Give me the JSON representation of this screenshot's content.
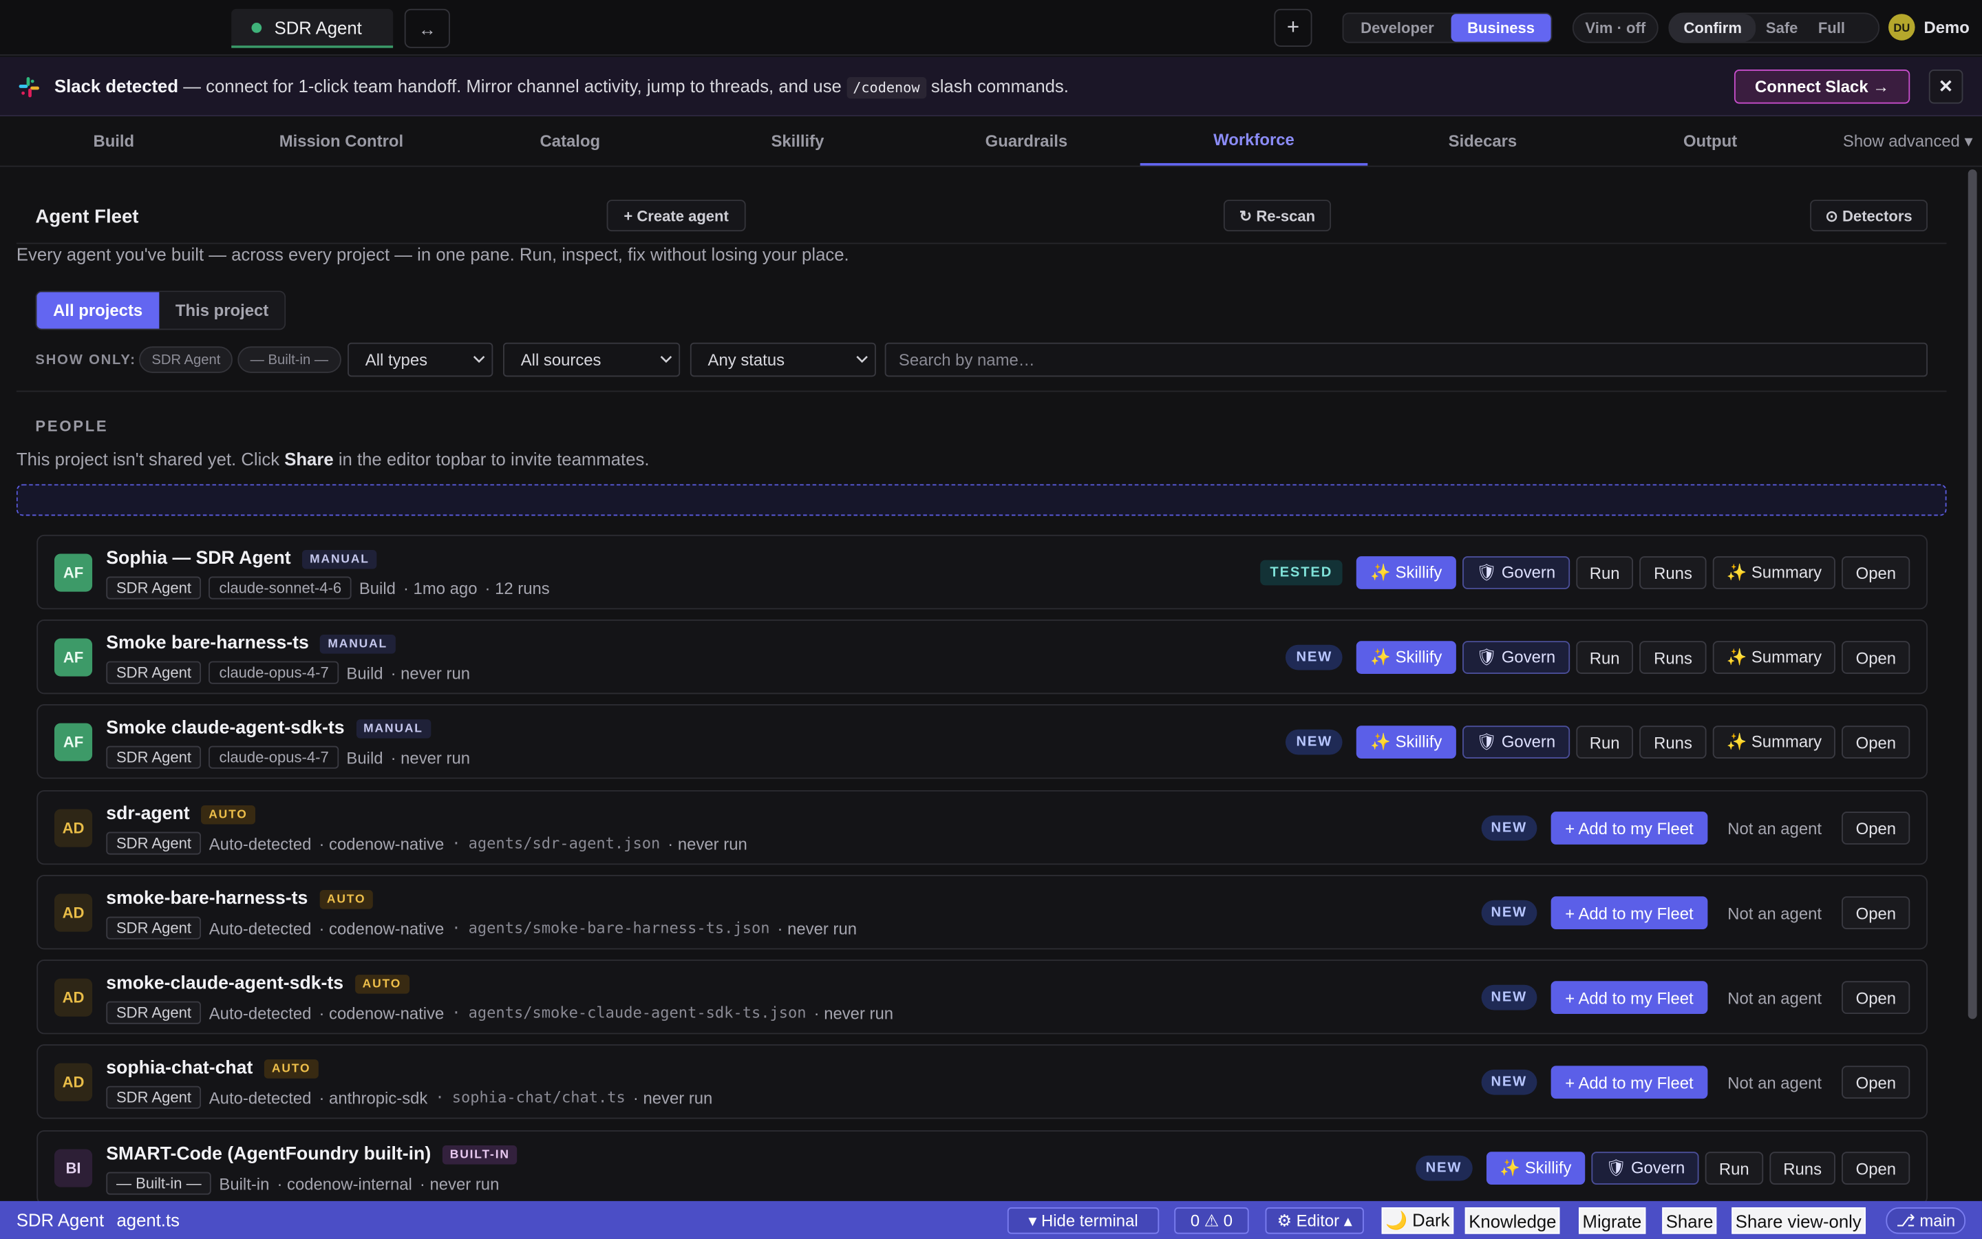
{
  "topbar": {
    "tab_label": "SDR Agent",
    "swap_label": "↔",
    "new_label": "+",
    "modes": [
      "Developer",
      "Business"
    ],
    "active_mode": "Business",
    "vim_label": "Vim · off",
    "safety": [
      "Confirm",
      "Safe",
      "Full"
    ],
    "active_safety": "Confirm",
    "user_initials": "DU",
    "user_name": "Demo"
  },
  "banner": {
    "title": "Slack detected",
    "text_before": " — connect for 1-click team handoff. Mirror channel activity, jump to threads, and use ",
    "code": "/codenow",
    "text_after": " slash commands.",
    "connect_label": "Connect Slack →",
    "close_label": "✕"
  },
  "nav": {
    "tabs": [
      "Build",
      "Mission Control",
      "Catalog",
      "Skillify",
      "Guardrails",
      "Workforce",
      "Sidecars",
      "Output"
    ],
    "active": "Workforce",
    "show_advanced": "Show advanced ▾"
  },
  "fleet": {
    "title": "Agent Fleet",
    "create_label": "+ Create agent",
    "rescan_label": "↻ Re-scan",
    "detectors_label": "⊙ Detectors",
    "subtitle": "Every agent you've built — across every project — in one pane. Run, inspect, fix without losing your place.",
    "scope": [
      "All projects",
      "This project"
    ],
    "active_scope": "All projects"
  },
  "filters": {
    "label": "SHOW ONLY:",
    "chips": [
      "SDR Agent",
      "— Built-in —"
    ],
    "types": "All types",
    "sources": "All sources",
    "status": "Any status",
    "search_placeholder": "Search by name…"
  },
  "people": {
    "heading": "PEOPLE",
    "text_before": "This project isn't shared yet. Click ",
    "text_bold": "Share",
    "text_after": " in the editor topbar to invite teammates."
  },
  "agents": [
    {
      "initials": "AF",
      "name": "Sophia — SDR Agent",
      "tag": "MANUAL",
      "project": "SDR Agent",
      "model": "claude-sonnet-4-6",
      "meta": "Build",
      "extra": "· 1mo ago",
      "extra2": "· 12 runs",
      "status": "TESTED",
      "actions": [
        "✨ Skillify",
        "🛡 Govern",
        "Run",
        "Runs",
        "✨ Summary",
        "Open"
      ]
    },
    {
      "initials": "AF",
      "name": "Smoke bare-harness-ts",
      "tag": "MANUAL",
      "project": "SDR Agent",
      "model": "claude-opus-4-7",
      "meta": "Build",
      "extra": "· never run",
      "status": "NEW",
      "actions": [
        "✨ Skillify",
        "🛡 Govern",
        "Run",
        "Runs",
        "✨ Summary",
        "Open"
      ]
    },
    {
      "initials": "AF",
      "name": "Smoke claude-agent-sdk-ts",
      "tag": "MANUAL",
      "project": "SDR Agent",
      "model": "claude-opus-4-7",
      "meta": "Build",
      "extra": "· never run",
      "status": "NEW",
      "actions": [
        "✨ Skillify",
        "🛡 Govern",
        "Run",
        "Runs",
        "✨ Summary",
        "Open"
      ]
    },
    {
      "initials": "AD",
      "name": "sdr-agent",
      "tag": "AUTO",
      "project": "SDR Agent",
      "meta": "Auto-detected",
      "source": "· codenow-native",
      "path": "agents/sdr-agent.json",
      "extra": "· never run",
      "status": "NEW",
      "actions": [
        "+ Add to my Fleet",
        "Not an agent",
        "Open"
      ]
    },
    {
      "initials": "AD",
      "name": "smoke-bare-harness-ts",
      "tag": "AUTO",
      "project": "SDR Agent",
      "meta": "Auto-detected",
      "source": "· codenow-native",
      "path": "agents/smoke-bare-harness-ts.json",
      "extra": "· never run",
      "status": "NEW",
      "actions": [
        "+ Add to my Fleet",
        "Not an agent",
        "Open"
      ]
    },
    {
      "initials": "AD",
      "name": "smoke-claude-agent-sdk-ts",
      "tag": "AUTO",
      "project": "SDR Agent",
      "meta": "Auto-detected",
      "source": "· codenow-native",
      "path": "agents/smoke-claude-agent-sdk-ts.json",
      "extra": "· never run",
      "status": "NEW",
      "actions": [
        "+ Add to my Fleet",
        "Not an agent",
        "Open"
      ]
    },
    {
      "initials": "AD",
      "name": "sophia-chat-chat",
      "tag": "AUTO",
      "project": "SDR Agent",
      "meta": "Auto-detected",
      "source": "· anthropic-sdk",
      "path": "sophia-chat/chat.ts",
      "extra": "· never run",
      "status": "NEW",
      "actions": [
        "+ Add to my Fleet",
        "Not an agent",
        "Open"
      ]
    },
    {
      "initials": "BI",
      "name": "SMART-Code (AgentFoundry built-in)",
      "tag": "BUILT-IN",
      "project": "— Built-in —",
      "meta": "Built-in",
      "source": "· codenow-internal",
      "extra": "· never run",
      "status": "NEW",
      "actions": [
        "✨ Skillify",
        "🛡 Govern",
        "Run",
        "Runs",
        "Open"
      ]
    }
  ],
  "statusbar": {
    "project": "SDR Agent",
    "file": "agent.ts",
    "hide_terminal": "▾ Hide terminal",
    "problems": "0 ⚠ 0",
    "editor": "⚙ Editor ▴",
    "dark": "🌙 Dark",
    "knowledge": "Knowledge",
    "migrate": "Migrate",
    "share": "Share",
    "share_view": "Share view-only",
    "branch": "⎇ main"
  },
  "colors": {
    "accent": "#6366f1",
    "statusbar": "#4b4ec6",
    "new_badge": "#1f2a55",
    "tested_badge": "#133236",
    "auto_tag": "#382a12"
  }
}
